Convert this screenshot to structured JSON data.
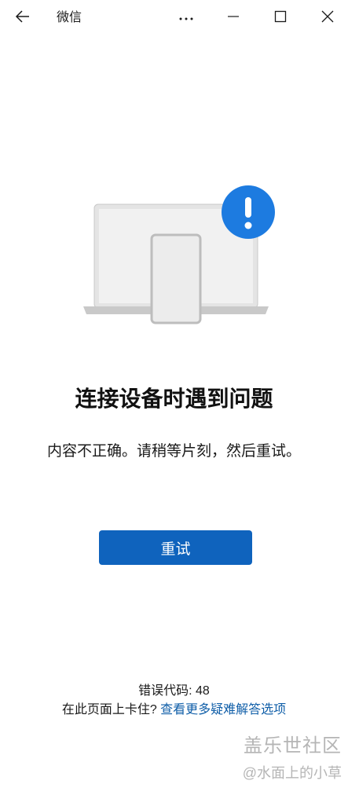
{
  "titlebar": {
    "app_title": "微信",
    "back_icon": "arrow-left-icon",
    "more_icon": "more-horizontal-icon",
    "minimize_icon": "minimize-icon",
    "maximize_icon": "maximize-icon",
    "close_icon": "close-icon"
  },
  "illustration": {
    "alert_color": "#1d7be0",
    "alert_symbol": "!"
  },
  "content": {
    "heading": "连接设备时遇到问题",
    "message": "内容不正确。请稍等片刻，然后重试。",
    "retry_label": "重试",
    "error_code": "错误代码: 48",
    "help_prefix": "在此页面上卡住? ",
    "help_link": "查看更多疑难解答选项"
  },
  "colors": {
    "accent": "#0f63bd",
    "link": "#0f5ea8"
  },
  "watermark": {
    "brand": "盖乐世社区",
    "user": "@水面上的小草"
  }
}
